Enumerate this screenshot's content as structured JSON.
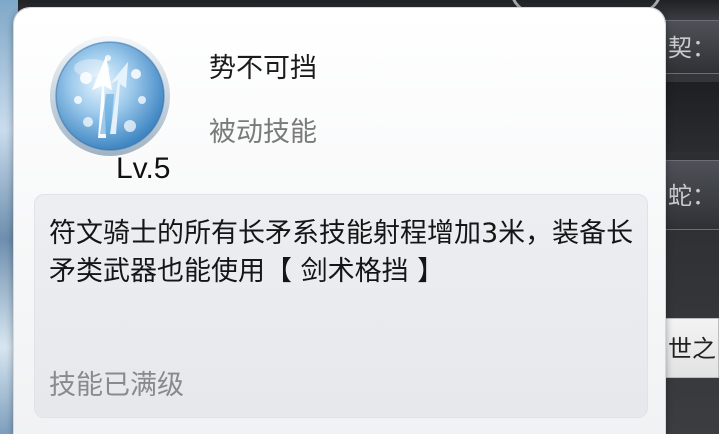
{
  "skill": {
    "name": "势不可挡",
    "type": "被动技能",
    "level": "Lv.5",
    "icon": "rune-spear-skill-icon",
    "description": "符文骑士的所有长矛系技能射程增加3米，装备长矛类武器也能使用【 剑术格挡 】",
    "status": "技能已满级"
  },
  "background": {
    "right_rows": [
      "契：",
      "蛇：",
      "世之"
    ]
  },
  "colors": {
    "panel": "#f6f7f8",
    "desc_box": "#e8eaee",
    "icon_blue": "#5a9fd4",
    "status_gray": "#8a8a8a"
  }
}
